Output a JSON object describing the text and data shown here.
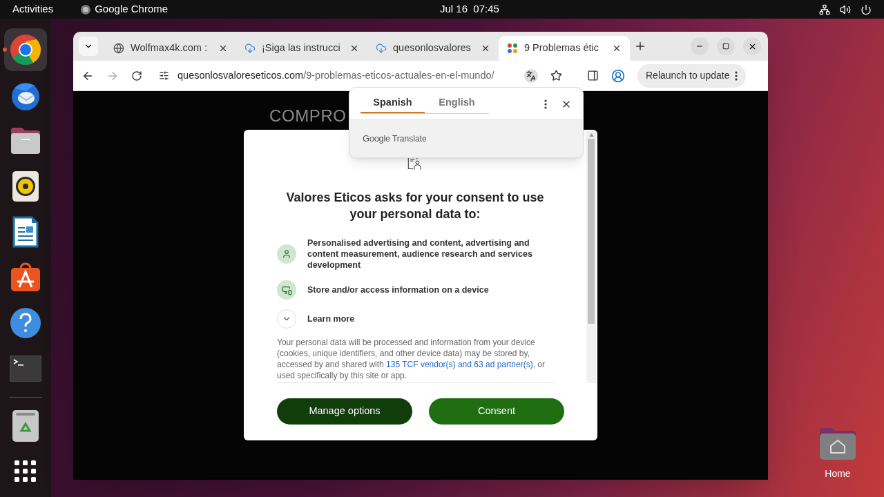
{
  "top_bar": {
    "activities": "Activities",
    "app_name": "Google Chrome",
    "clock": "Jul 16  07:45"
  },
  "dock": {
    "items": [
      {
        "kind": "chrome",
        "running": true
      },
      {
        "kind": "mail",
        "running": false
      },
      {
        "kind": "files",
        "running": false
      },
      {
        "kind": "music",
        "running": false
      },
      {
        "kind": "writer",
        "running": false
      },
      {
        "kind": "store",
        "running": false
      },
      {
        "kind": "help",
        "running": false
      },
      {
        "kind": "terminal",
        "running": false
      },
      {
        "kind": "trash",
        "running": false
      },
      {
        "kind": "apps",
        "running": false
      }
    ]
  },
  "desktop_icons": [
    {
      "label": "Home"
    }
  ],
  "browser": {
    "tabs": [
      {
        "title": "Wolfmax4k.com :",
        "kind": "globe",
        "selected": false
      },
      {
        "title": "¡Siga las instrucci",
        "kind": "download",
        "selected": false
      },
      {
        "title": "quesonlosvalores",
        "kind": "download",
        "selected": false
      },
      {
        "title": "9 Problemas étic",
        "kind": "site",
        "selected": true
      }
    ],
    "address": {
      "domain": "quesonlosvaloreseticos.com",
      "path": "/9-problemas-eticos-actuales-en-el-mundo/"
    },
    "relaunch_button": "Relaunch to update"
  },
  "translate_popup": {
    "languages": [
      {
        "label": "Spanish",
        "selected": true
      },
      {
        "label": "English",
        "selected": false
      }
    ],
    "brand": "Google",
    "product": "Translate"
  },
  "page": {
    "heading": "COMPRO"
  },
  "consent": {
    "title": "Valores Eticos asks for your consent to use your personal data to:",
    "purposes": [
      {
        "kind": "person",
        "text": "Personalised advertising and content, advertising and content measurement, audience research and services development"
      },
      {
        "kind": "devices",
        "text": "Store and/or access information on a device"
      }
    ],
    "learn_more": {
      "label": "Learn more",
      "expanded": false
    },
    "notice": {
      "before": "Your personal data will be processed and information from your device (cookies, unique identifiers, and other device data) may be stored by, accessed by and shared with",
      "link": "135 TCF vendor(s) and 63 ad partner(s)",
      "after": ", or used specifically by this site or app."
    },
    "buttons": [
      {
        "label": "Manage options",
        "kind": "secondary"
      },
      {
        "label": "Consent",
        "kind": "primary"
      }
    ]
  }
}
